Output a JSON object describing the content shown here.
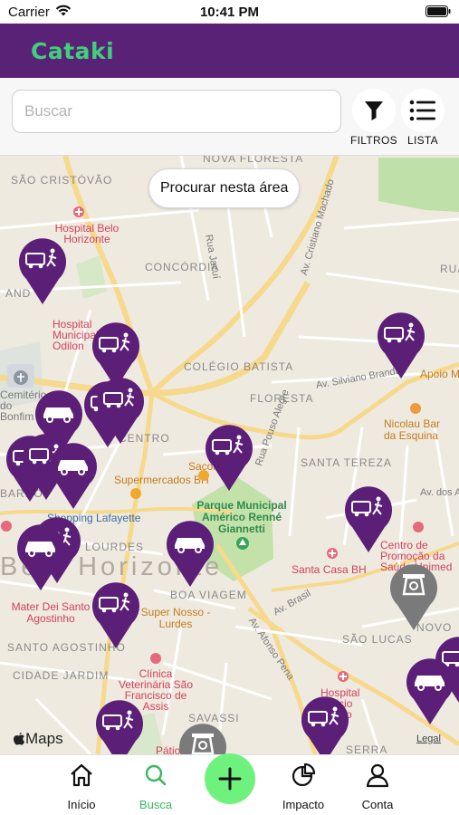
{
  "status_bar": {
    "carrier": "Carrier",
    "time": "10:41 PM"
  },
  "header": {
    "logo_text": "Cataki"
  },
  "search": {
    "placeholder": "Buscar",
    "filters_label": "FILTROS",
    "list_label": "LISTA"
  },
  "map": {
    "search_area_button": "Procurar nesta área",
    "maps_brand": "Maps",
    "legal_link": "Legal",
    "neighborhood_labels": {
      "nova_floresta": "NOVA FLORESTA",
      "sao_cristovao": "SÃO CRISTÓVÃO",
      "concordia": "CONCÓRDIA",
      "colegio_batista": "COLÉGIO BATISTA",
      "floresta": "FLORESTA",
      "santa_tereza": "SANTA TEREZA",
      "centro": "CENTRO",
      "lourdes": "LOURDES",
      "boa_viagem": "BOA VIAGEM",
      "sao_lucas": "SÃO LUCAS",
      "santo_agostinho": "SANTO AGOSTINHO",
      "cidade_jardim": "CIDADE JARDIM",
      "savassi": "SAVASSI",
      "serra": "SERRA",
      "barro_preto": "BARRO",
      "santa_efigenia": "SANTA",
      "novo": "NOVO",
      "ruas": "RUAS",
      "andradas": "AND",
      "belo_horizonte": "Belo Horizonte"
    },
    "poi_labels": {
      "hospital_belo_horizonte": "Hospital Belo Horizonte",
      "hospital_odilon": "Hospital Municipal Odilon",
      "cemiterio": "Cemitério do Bonfim",
      "supermercados_bh": "Supermercados BH",
      "sacolao": "Sacolão",
      "shopping_lafayette": "Shopping Lafayette",
      "parque_municipal": "Parque Municipal Américo Renné Giannetti",
      "nicolau_bar": "Nicolau Bar da Esquina",
      "apoio": "Apoio M",
      "santa_casa": "Santa Casa BH",
      "centro_promocao": "Centro de Promoção da Saúde Unimed",
      "mater_dei": "Mater Dei Santo Agostinho",
      "super_nosso": "Super Nosso - Lurdes",
      "clinica_veterinaria": "Clínica Veterinária São Francisco de Assis",
      "hospital_felicio": "Hospital Felício Rocho",
      "patio": "Pátio"
    },
    "road_labels": {
      "rua_jacui": "Rua Jacuí",
      "av_cristiano": "Av. Cristiano Machado",
      "av_silviano": "Av. Silviano Brandão",
      "rua_pouso_alegre": "Rua Pouso Alegre",
      "av_brasil": "Av. Brasil",
      "av_afonso_pena": "Av. Afonso Pena",
      "av_dos_andradas": "Av. dos A"
    },
    "pin_types": [
      "truck-collector",
      "car-collector",
      "car",
      "truck",
      "scale"
    ],
    "colors": {
      "pin": "#5b1f78",
      "pin_alt": "#7a7a7a",
      "map_bg": "#efeae0",
      "brand": "#5a2277",
      "accent": "#3ed07a"
    }
  },
  "tabs": [
    {
      "label": "Início",
      "icon": "home-icon",
      "active": false
    },
    {
      "label": "Busca",
      "icon": "search-icon",
      "active": true
    },
    {
      "label": "Impacto",
      "icon": "pie-chart-icon",
      "active": false
    },
    {
      "label": "Conta",
      "icon": "user-icon",
      "active": false
    }
  ]
}
